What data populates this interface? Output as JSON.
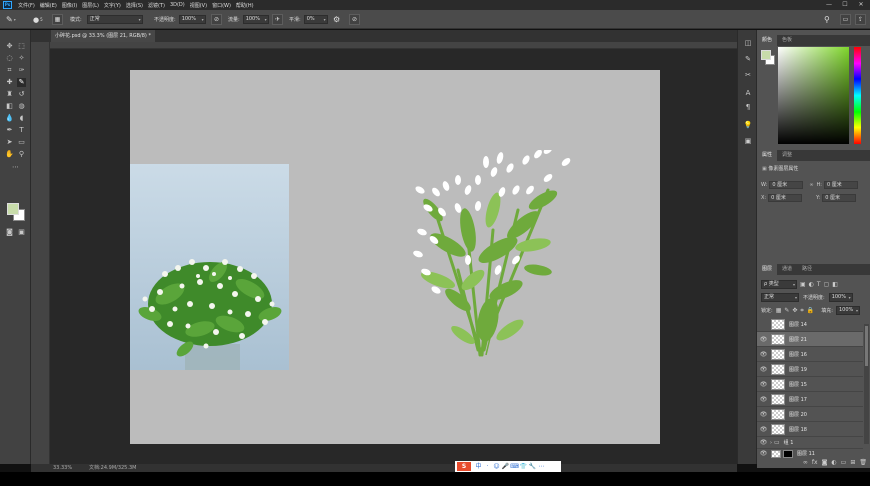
{
  "menu": [
    "文件(F)",
    "编辑(E)",
    "图像(I)",
    "图层(L)",
    "文字(Y)",
    "选择(S)",
    "滤镜(T)",
    "3D(D)",
    "视图(V)",
    "窗口(W)",
    "帮助(H)"
  ],
  "app_logo": "Ps",
  "window_controls": [
    "—",
    "☐",
    "✕"
  ],
  "options": {
    "brush_size": "5",
    "mode_label": "模式:",
    "mode_value": "正常",
    "opacity_label": "不透明度:",
    "opacity_value": "100%",
    "flow_label": "流量:",
    "flow_value": "100%",
    "smoothing_label": "平滑:",
    "smoothing_value": "0%"
  },
  "document": {
    "tab_title": "小碎花.psd @ 33.3% (图层 21, RGB/8) *",
    "zoom": "33.33%",
    "doc_size": "文档:24.9M/325.3M"
  },
  "panels": {
    "color_tabs": [
      "颜色",
      "色板"
    ],
    "properties_tabs": [
      "属性",
      "调整"
    ],
    "properties_title": "像素图层属性",
    "w_label": "W:",
    "w_value": "0 厘米",
    "h_label": "H:",
    "h_value": "0 厘米",
    "x_label": "X:",
    "x_value": "0 厘米",
    "y_label": "Y:",
    "y_value": "0 厘米",
    "go_icon": "GO",
    "layers_tabs": [
      "图层",
      "通道",
      "路径"
    ],
    "filter_label": "ρ 类型",
    "blend_mode": "正常",
    "layer_opacity_label": "不透明度:",
    "layer_opacity_value": "100%",
    "lock_label": "锁定:",
    "fill_label": "填充:",
    "fill_value": "100%"
  },
  "layers": [
    {
      "name": "图层 14",
      "visible": false,
      "selected": false
    },
    {
      "name": "图层 21",
      "visible": true,
      "selected": true
    },
    {
      "name": "图层 16",
      "visible": true,
      "selected": false
    },
    {
      "name": "图层 19",
      "visible": true,
      "selected": false
    },
    {
      "name": "图层 15",
      "visible": true,
      "selected": false
    },
    {
      "name": "图层 17",
      "visible": true,
      "selected": false
    },
    {
      "name": "图层 20",
      "visible": true,
      "selected": false
    },
    {
      "name": "图层 18",
      "visible": true,
      "selected": false
    },
    {
      "name": "组 1",
      "visible": true,
      "selected": false
    },
    {
      "name": "图层 11",
      "visible": true,
      "selected": false
    }
  ],
  "ime": {
    "logo": "S",
    "icons": [
      "中",
      "·",
      "☺",
      "🎤",
      "⌨",
      "👕",
      "🔧",
      "⋯"
    ]
  },
  "colors": {
    "foreground": "#c8dcaa",
    "background": "#ffffff",
    "canvas": "#bcbcbc",
    "leaf": "#6faa3c",
    "leaf_light": "#8cc257"
  }
}
